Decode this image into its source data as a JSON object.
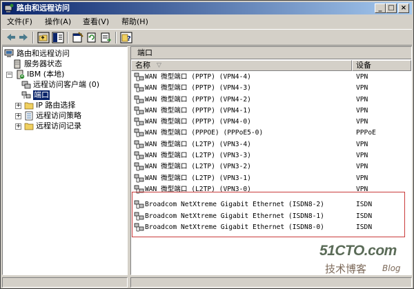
{
  "window": {
    "title": "路由和远程访问"
  },
  "menu": [
    "文件(F)",
    "操作(A)",
    "查看(V)",
    "帮助(H)"
  ],
  "tree": {
    "root": "路由和远程访问",
    "server_status": "服务器状态",
    "server": "IBM (本地)",
    "children": [
      "远程访问客户端 (0)",
      "端口",
      "IP 路由选择",
      "远程访问策略",
      "远程访问记录"
    ]
  },
  "list": {
    "caption": "端口",
    "columns": {
      "name": "名称",
      "device": "设备"
    },
    "rows": [
      {
        "name": "WAN 微型端口 (PPTP) (VPN4-4)",
        "device": "VPN"
      },
      {
        "name": "WAN 微型端口 (PPTP) (VPN4-3)",
        "device": "VPN"
      },
      {
        "name": "WAN 微型端口 (PPTP) (VPN4-2)",
        "device": "VPN"
      },
      {
        "name": "WAN 微型端口 (PPTP) (VPN4-1)",
        "device": "VPN"
      },
      {
        "name": "WAN 微型端口 (PPTP) (VPN4-0)",
        "device": "VPN"
      },
      {
        "name": "WAN 微型端口 (PPPOE) (PPPoE5-0)",
        "device": "PPPoE"
      },
      {
        "name": "WAN 微型端口 (L2TP) (VPN3-4)",
        "device": "VPN"
      },
      {
        "name": "WAN 微型端口 (L2TP) (VPN3-3)",
        "device": "VPN"
      },
      {
        "name": "WAN 微型端口 (L2TP) (VPN3-2)",
        "device": "VPN"
      },
      {
        "name": "WAN 微型端口 (L2TP) (VPN3-1)",
        "device": "VPN"
      },
      {
        "name": "WAN 微型端口 (L2TP) (VPN3-0)",
        "device": "VPN"
      }
    ],
    "isdn_rows": [
      {
        "name": "Broadcom NetXtreme Gigabit Ethernet (ISDN8-2)",
        "device": "ISDN"
      },
      {
        "name": "Broadcom NetXtreme Gigabit Ethernet (ISDN8-1)",
        "device": "ISDN"
      },
      {
        "name": "Broadcom NetXtreme Gigabit Ethernet (ISDN8-0)",
        "device": "ISDN"
      }
    ]
  },
  "watermark": {
    "site": "51CTO.com",
    "sub": "技术博客",
    "blog": "Blog"
  },
  "colors": {
    "title_bar": "#0a246a",
    "highlight_border": "#c93a3a",
    "selection": "#0a246a"
  }
}
